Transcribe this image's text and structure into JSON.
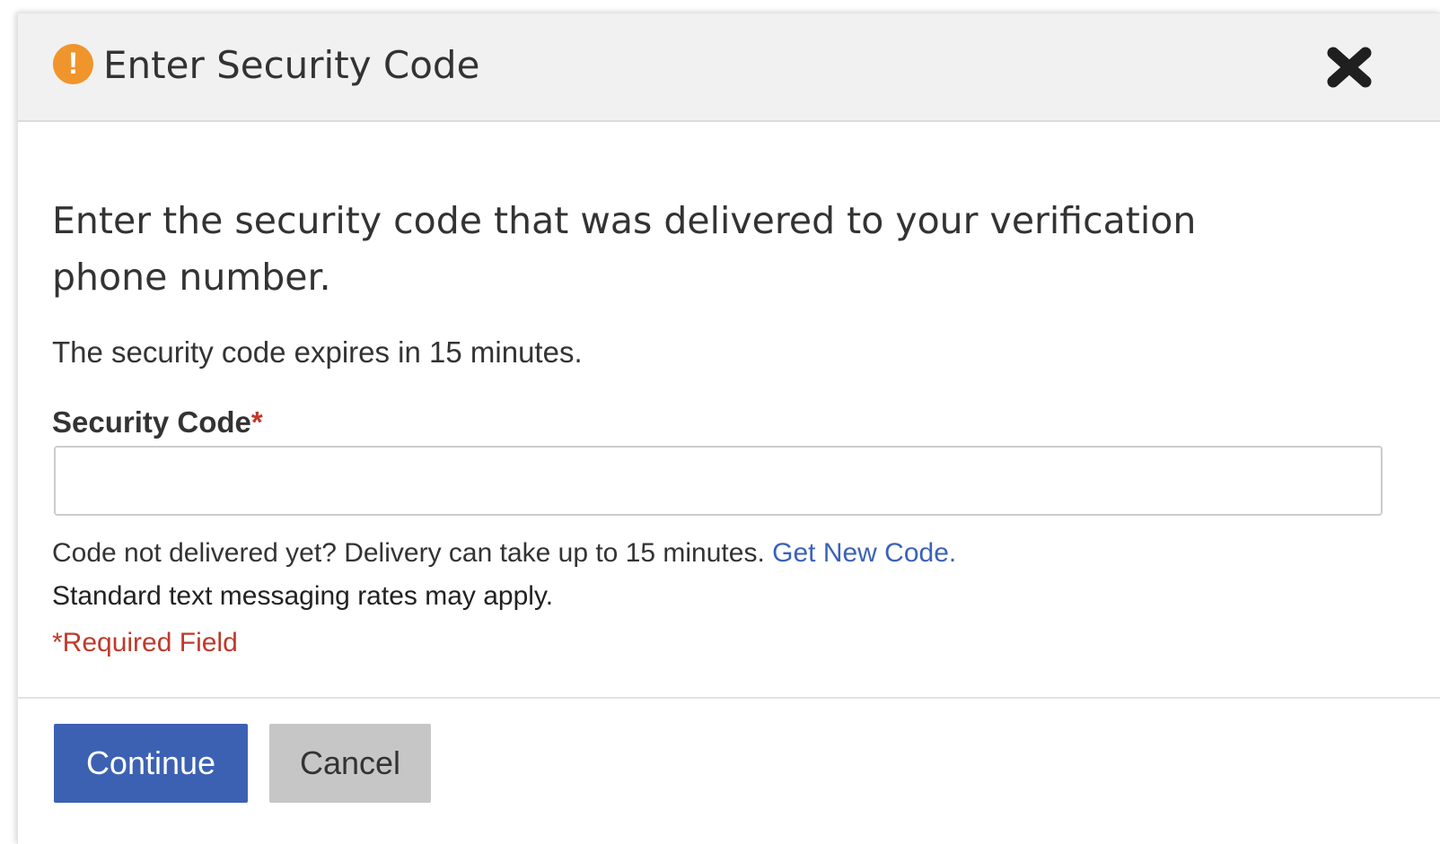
{
  "dialog": {
    "title": "Enter Security Code",
    "alert_icon_glyph": "!",
    "alert_icon": "exclamation-circle-icon",
    "close_icon": "close-x-icon",
    "accent_color": "#f0952c"
  },
  "body": {
    "intro": "Enter the security code that was delivered to your verification phone number.",
    "expiry_note": "The security code expires in 15 minutes.",
    "field": {
      "label": "Security Code",
      "required_marker": "*",
      "value": "",
      "placeholder": ""
    },
    "delivery_note": "Code not delivered yet? Delivery can take up to 15 minutes.",
    "new_code_link": "Get New Code.",
    "rates_note": "Standard text messaging rates may apply.",
    "required_note": "*Required Field"
  },
  "footer": {
    "continue_label": "Continue",
    "cancel_label": "Cancel",
    "primary_color": "#3c61b3",
    "link_color": "#3b62b8",
    "required_color": "#c0392b"
  }
}
